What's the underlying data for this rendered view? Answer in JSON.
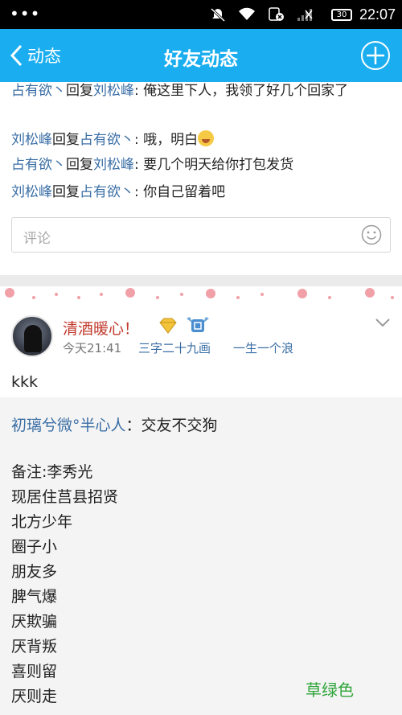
{
  "status_bar": {
    "time": "22:07",
    "battery": "30"
  },
  "nav": {
    "back_label": "动态",
    "title": "好友动态"
  },
  "comments": [
    {
      "user": "占有欲丶",
      "verb": "回复",
      "target": "刘松峰",
      "text": ": 俺这里下人，我领了好几个回家了"
    },
    {
      "user": "刘松峰",
      "verb": "回复",
      "target": "占有欲丶",
      "text": ": 哦，明白"
    },
    {
      "user": "占有欲丶",
      "verb": "回复",
      "target": "刘松峰",
      "text": ": 要几个明天给你打包发货"
    },
    {
      "user": "刘松峰",
      "verb": "回复",
      "target": "占有欲丶",
      "text": ": 你自己留着吧"
    }
  ],
  "comment_input": {
    "placeholder": "评论"
  },
  "post": {
    "author": "清酒暖心！",
    "time": "今天21:41",
    "tags": [
      "三字二十九画",
      "一生一个浪"
    ],
    "text": "kkk",
    "share": {
      "source_user": "初璃兮微°半心人",
      "source_text": "：交友不交狗",
      "lines": [
        "备注:李秀光",
        "现居住莒县招贤",
        "北方少年",
        "圈子小",
        "朋友多",
        "脾气爆",
        "厌欺骗",
        "厌背叛",
        "喜则留",
        "厌则走"
      ]
    }
  },
  "watermark": "草绿色",
  "colors": {
    "nav_bg": "#1aaef0",
    "link": "#3a6ea5",
    "author": "#c0392b",
    "watermark": "#2fa53a"
  }
}
